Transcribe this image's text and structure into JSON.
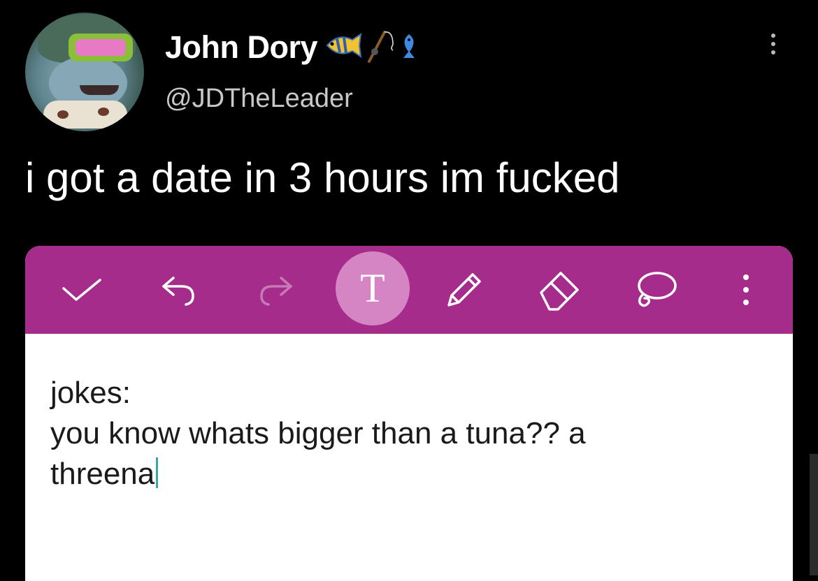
{
  "tweet": {
    "name": "John Dory",
    "handle": "@JDTheLeader",
    "text": "i got a date in 3 hours im fucked",
    "name_emojis": [
      "tropical-fish-icon",
      "fishing-pole-icon",
      "fish-icon"
    ]
  },
  "editor": {
    "toolbar_color": "#a52c8a",
    "active_tool_color": "#d685c4",
    "text_tool_letter": "T",
    "tools": [
      "check-icon",
      "undo-icon",
      "redo-icon",
      "text-tool-icon",
      "pencil-icon",
      "eraser-icon",
      "lasso-icon",
      "more-vertical-icon"
    ],
    "note_lines": [
      "jokes:",
      "you know whats bigger than a tuna?? a",
      "threena"
    ],
    "caret_color": "#3aa6a6"
  }
}
